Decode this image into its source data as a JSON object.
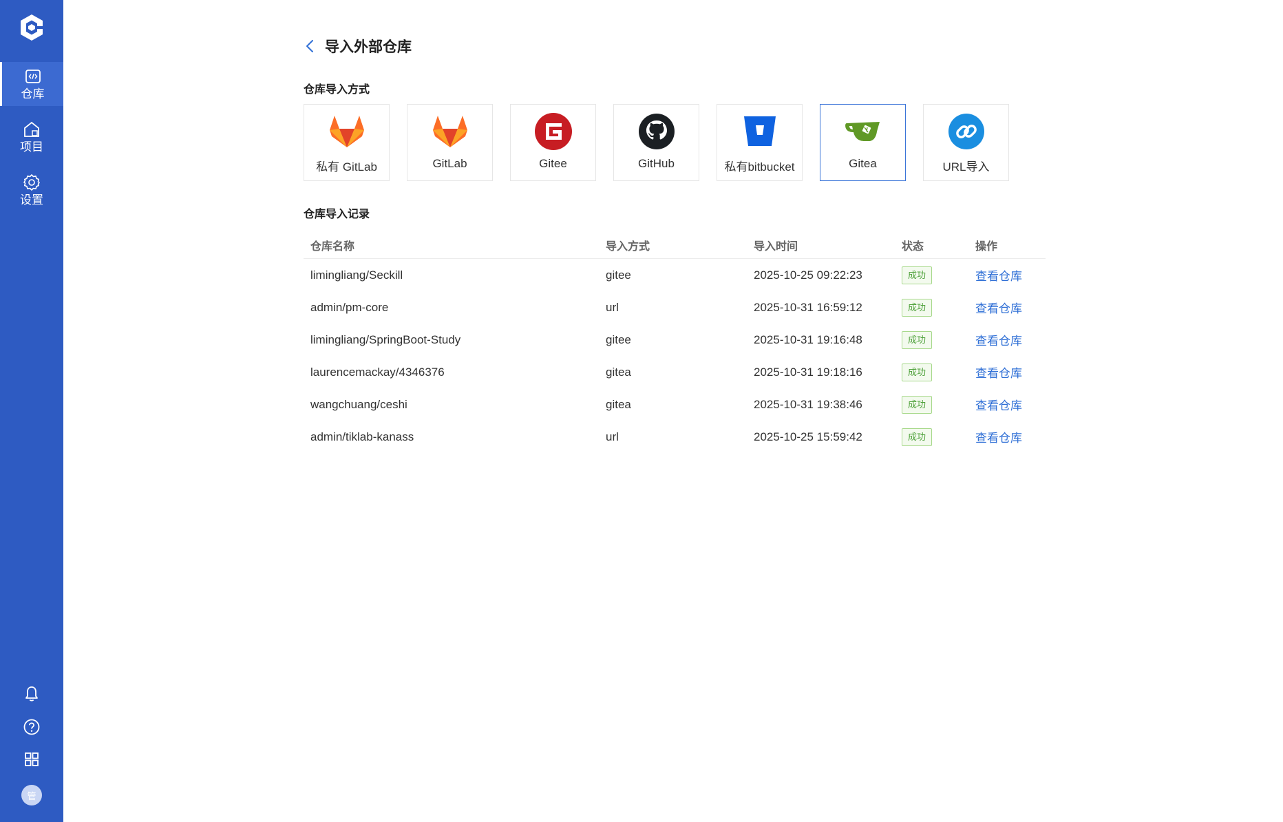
{
  "sidebar": {
    "items": [
      {
        "label": "仓库",
        "icon": "repo-icon",
        "active": true
      },
      {
        "label": "项目",
        "icon": "project-icon",
        "active": false
      },
      {
        "label": "设置",
        "icon": "gear-icon",
        "active": false
      }
    ],
    "bottom_icons": [
      "bell-icon",
      "help-icon",
      "apps-grid-icon"
    ],
    "avatar_text": "管"
  },
  "header": {
    "title": "导入外部仓库"
  },
  "import_methods": {
    "title": "仓库导入方式",
    "cards": [
      {
        "label": "私有 GitLab",
        "icon": "gitlab-icon"
      },
      {
        "label": "GitLab",
        "icon": "gitlab-icon"
      },
      {
        "label": "Gitee",
        "icon": "gitee-icon"
      },
      {
        "label": "GitHub",
        "icon": "github-icon"
      },
      {
        "label": "私有bitbucket",
        "icon": "bitbucket-icon"
      },
      {
        "label": "Gitea",
        "icon": "gitea-icon",
        "selected": true
      },
      {
        "label": "URL导入",
        "icon": "link-icon"
      }
    ]
  },
  "records": {
    "title": "仓库导入记录",
    "columns": [
      "仓库名称",
      "导入方式",
      "导入时间",
      "状态",
      "操作"
    ],
    "rows": [
      {
        "name": "limingliang/Seckill",
        "method": "gitee",
        "time": "2025-10-25 09:22:23",
        "status": "成功",
        "action": "查看仓库"
      },
      {
        "name": "admin/pm-core",
        "method": "url",
        "time": "2025-10-31 16:59:12",
        "status": "成功",
        "action": "查看仓库"
      },
      {
        "name": "limingliang/SpringBoot-Study",
        "method": "gitee",
        "time": "2025-10-31 19:16:48",
        "status": "成功",
        "action": "查看仓库"
      },
      {
        "name": "laurencemackay/4346376",
        "method": "gitea",
        "time": "2025-10-31 19:18:16",
        "status": "成功",
        "action": "查看仓库"
      },
      {
        "name": "wangchuang/ceshi",
        "method": "gitea",
        "time": "2025-10-31 19:38:46",
        "status": "成功",
        "action": "查看仓库"
      },
      {
        "name": "admin/tiklab-kanass",
        "method": "url",
        "time": "2025-10-25 15:59:42",
        "status": "成功",
        "action": "查看仓库"
      }
    ]
  },
  "colors": {
    "sidebar": "#2e5bc2",
    "accent": "#2f6fd6",
    "success": "#4ea13a"
  }
}
